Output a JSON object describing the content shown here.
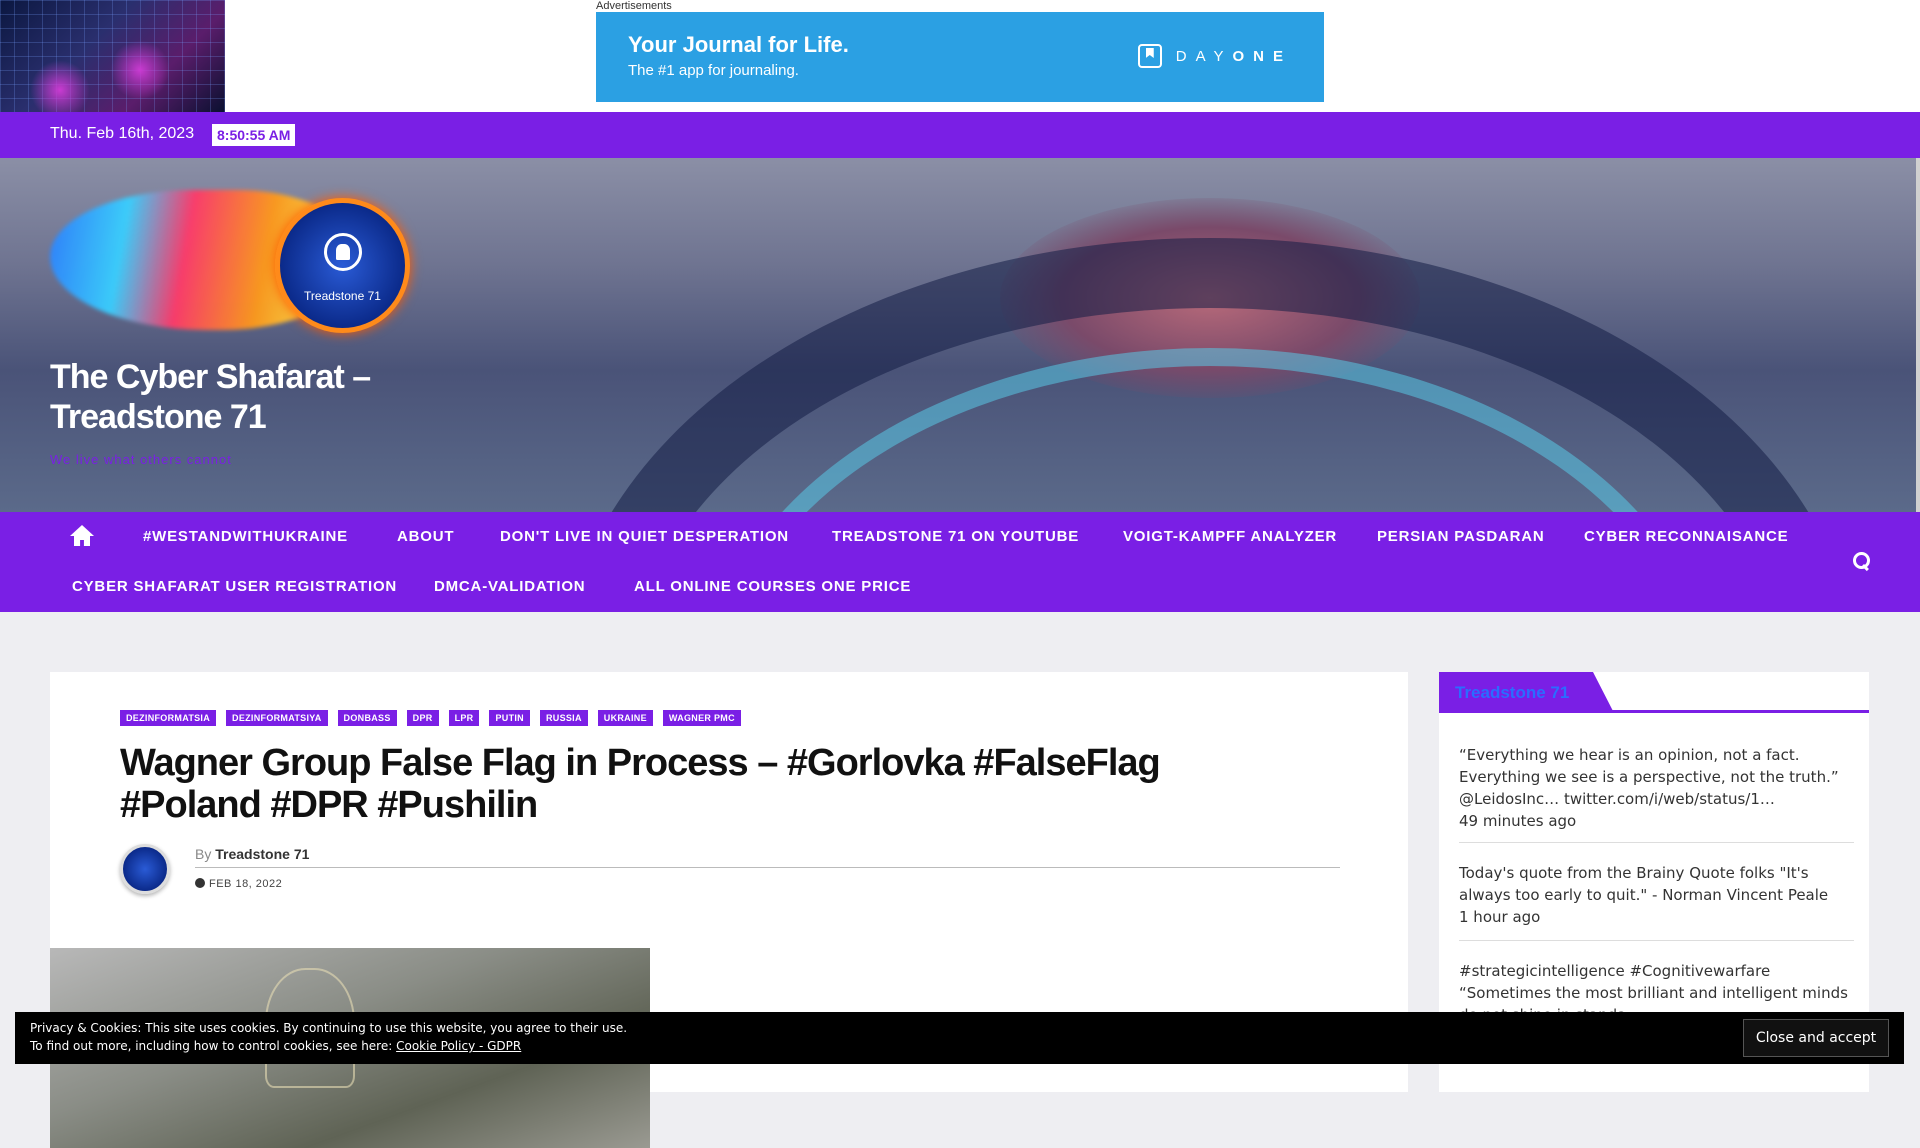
{
  "ad": {
    "label": "Advertisements",
    "headline": "Your Journal for Life.",
    "sub": "The #1 app for journaling.",
    "brand_light": "DAY",
    "brand_bold": "ONE",
    "color": "#2ba0e3"
  },
  "datebar": {
    "date": "Thu. Feb 16th, 2023",
    "time": "8:50:55 AM"
  },
  "site": {
    "title": "The Cyber Shafarat – Treadstone 71",
    "tagline": "We live what others cannot",
    "logo_caption": "Treadstone 71",
    "accent": "#7a1fe5"
  },
  "nav": {
    "row1": [
      "#WESTANDWITHUKRAINE",
      "ABOUT",
      "DON'T LIVE IN QUIET DESPERATION",
      "TREADSTONE 71 ON YOUTUBE",
      "VOIGT-KAMPFF ANALYZER",
      "PERSIAN PASDARAN",
      "CYBER RECONNAISANCE"
    ],
    "row2": [
      "CYBER SHAFARAT USER REGISTRATION",
      "DMCA-VALIDATION",
      "ALL ONLINE COURSES ONE PRICE"
    ]
  },
  "post": {
    "categories": [
      "DEZINFORMATSIA",
      "DEZINFORMATSIYA",
      "DONBASS",
      "DPR",
      "LPR",
      "PUTIN",
      "RUSSIA",
      "UKRAINE",
      "WAGNER PMC"
    ],
    "title": "Wagner Group False Flag in Process – #Gorlovka #FalseFlag #Poland #DPR #Pushilin",
    "by": "By",
    "author": "Treadstone 71",
    "date": "FEB 18, 2022"
  },
  "sidebar": {
    "title": "Treadstone 71",
    "tweets": [
      {
        "text": "“Everything we hear is an opinion, not a fact. Everything we see is a perspective, not the truth.” @LeidosInc… twitter.com/i/web/status/1…",
        "ago": "49 minutes ago"
      },
      {
        "text": "Today's quote from the Brainy Quote folks \"It's always too early to quit.\" - Norman Vincent Peale",
        "ago": "1 hour ago"
      },
      {
        "text": "#strategicintelligence #Cognitivewarfare “Sometimes the most brilliant and intelligent minds do not shine in standa…",
        "ago": ""
      }
    ]
  },
  "cookie": {
    "line1": "Privacy & Cookies: This site uses cookies. By continuing to use this website, you agree to their use.",
    "line2": "To find out more, including how to control cookies, see here:",
    "link": "Cookie Policy - GDPR",
    "button": "Close and accept"
  }
}
